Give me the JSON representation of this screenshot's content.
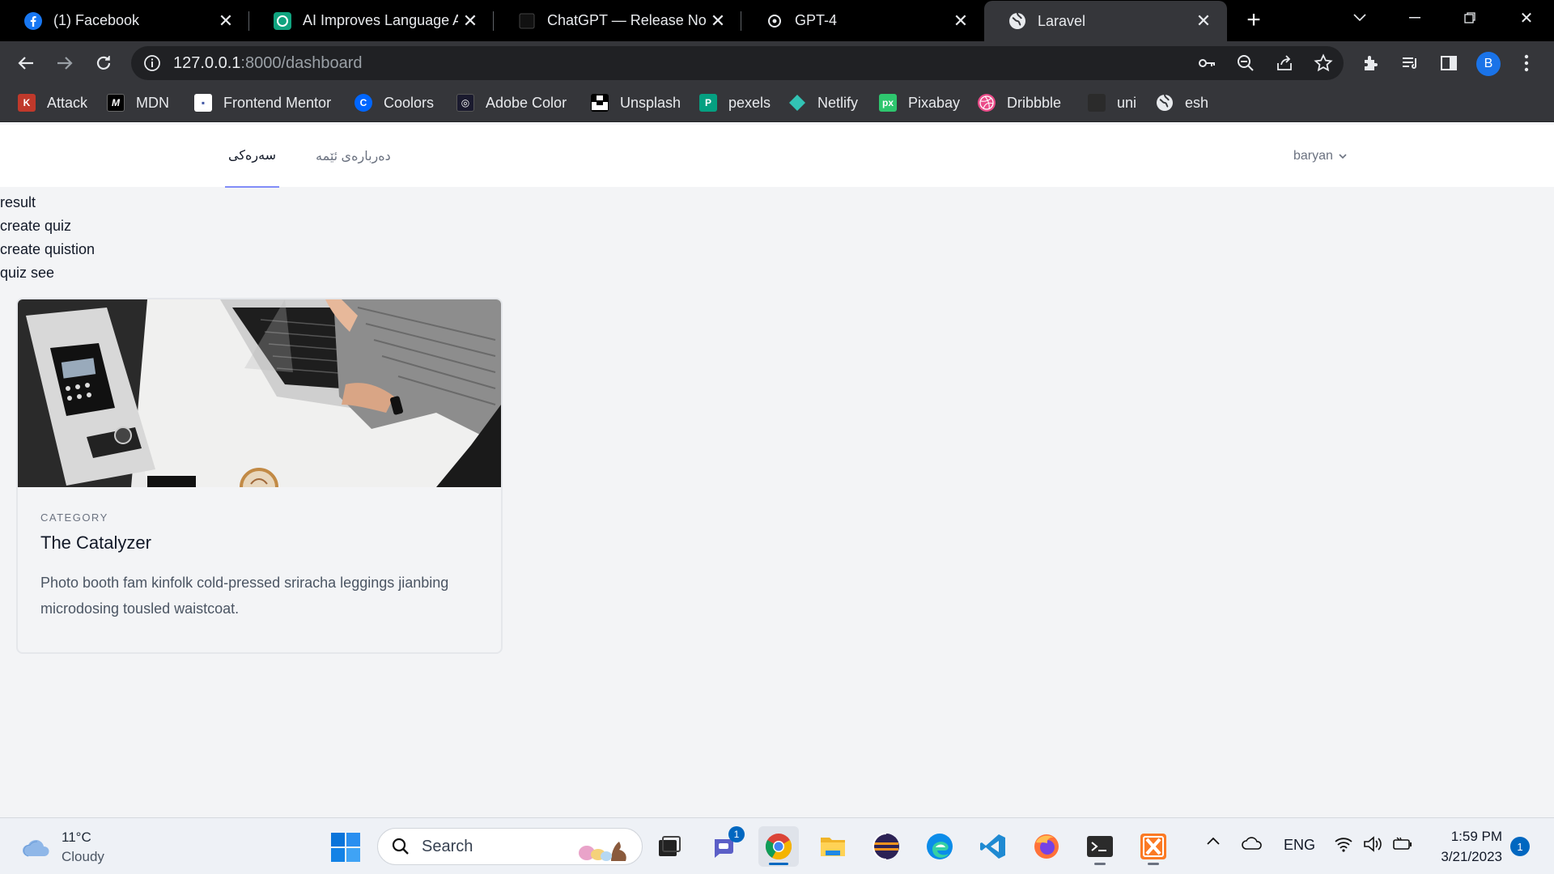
{
  "browser": {
    "tabs": [
      {
        "title": "(1) Facebook",
        "icon": "facebook-icon"
      },
      {
        "title": "AI Improves Language Ab",
        "icon": "openai-icon"
      },
      {
        "title": "ChatGPT — Release Note",
        "icon": "notion-icon"
      },
      {
        "title": "GPT-4",
        "icon": "openai-icon"
      },
      {
        "title": "Laravel",
        "icon": "globe-icon"
      }
    ],
    "url_host": "127.0.0.1",
    "url_rest": ":8000/dashboard",
    "profile_initial": "B",
    "bookmarks": [
      {
        "label": "Attack",
        "icon": "attack-icon",
        "color": "#c0392b"
      },
      {
        "label": "MDN",
        "icon": "mdn-icon",
        "color": "#000000"
      },
      {
        "label": "Frontend Mentor",
        "icon": "frontend-mentor-icon",
        "color": "#ffffff"
      },
      {
        "label": "Coolors",
        "icon": "coolors-icon",
        "color": "#0066ff"
      },
      {
        "label": "Adobe Color",
        "icon": "adobe-color-icon",
        "color": "#1a1a2e"
      },
      {
        "label": "Unsplash",
        "icon": "unsplash-icon",
        "color": "#000000"
      },
      {
        "label": "pexels",
        "icon": "pexels-icon",
        "color": "#05a081"
      },
      {
        "label": "Netlify",
        "icon": "netlify-icon",
        "color": "#32c3b4"
      },
      {
        "label": "Pixabay",
        "icon": "pixabay-icon",
        "color": "#2ec66e"
      },
      {
        "label": "Dribbble",
        "icon": "dribbble-icon",
        "color": "#ea4c89"
      },
      {
        "label": "uni",
        "icon": "uni-icon",
        "color": "#2b2b2b"
      },
      {
        "label": "esh",
        "icon": "globe-icon",
        "color": "#e8eaed"
      }
    ]
  },
  "app": {
    "nav": {
      "home": "سەرەکی",
      "about": "دەربارەی ئێمە",
      "user": "baryan"
    },
    "links": [
      "result",
      "create quiz",
      "create quistion",
      "quiz see"
    ],
    "card": {
      "category": "CATEGORY",
      "title": "The Catalyzer",
      "description": "Photo booth fam kinfolk cold-pressed sriracha leggings jianbing microdosing tousled waistcoat."
    }
  },
  "taskbar": {
    "weather_temp": "11°C",
    "weather_cond": "Cloudy",
    "search_label": "Search",
    "teams_badge": "1",
    "lang": "ENG",
    "time": "1:59 PM",
    "date": "3/21/2023",
    "notifications": "1"
  }
}
